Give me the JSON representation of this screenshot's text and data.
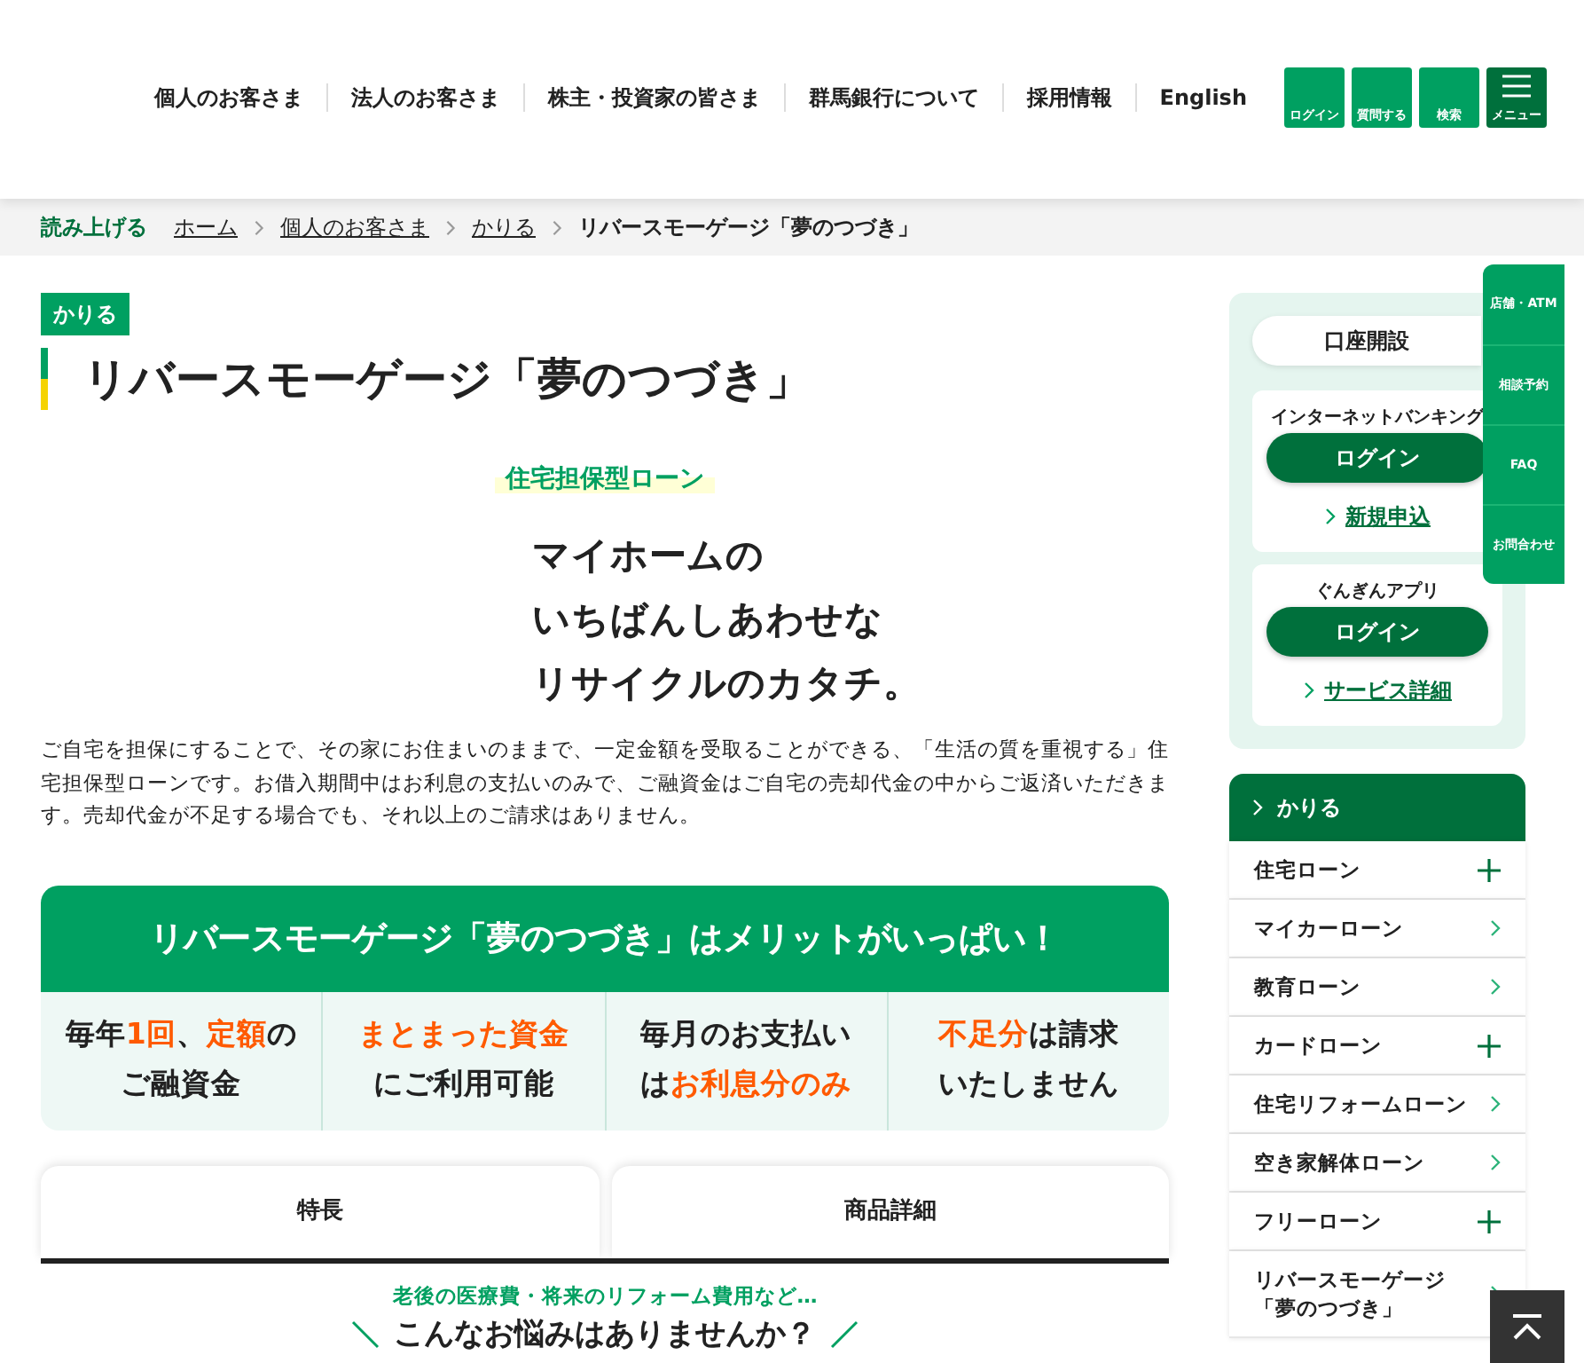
{
  "header": {
    "nav": [
      "個人のお客さま",
      "法人のお客さま",
      "株主・投資家の皆さま",
      "群馬銀行について",
      "採用情報",
      "English"
    ],
    "buttons": [
      {
        "label": "ログイン",
        "kind": "plain"
      },
      {
        "label": "質問する",
        "kind": "plain"
      },
      {
        "label": "検索",
        "kind": "plain"
      },
      {
        "label": "メニュー",
        "kind": "menu"
      }
    ]
  },
  "breadcrumb": {
    "read_aloud": "読み上げる",
    "items": [
      {
        "label": "ホーム",
        "current": false
      },
      {
        "label": "個人のお客さま",
        "current": false
      },
      {
        "label": "かりる",
        "current": false
      },
      {
        "label": "リバースモーゲージ「夢のつづき」",
        "current": true
      }
    ]
  },
  "category_badge": "かりる",
  "title": "リバースモーゲージ「夢のつづき」",
  "loan_type": "住宅担保型ローン",
  "catchphrase": [
    "マイホームの",
    "いちばんしあわせな",
    "リサイクルのカタチ。"
  ],
  "description": "ご自宅を担保にすることで、その家にお住まいのままで、一定金額を受取ることができる、「生活の質を重視する」住宅担保型ローンです。お借入期間中はお利息の支払いのみで、ご融資金はご自宅の売却代金の中からご返済いただきます。売却代金が不足する場合でも、それ以上のご請求はありません。",
  "merits": {
    "heading": "リバースモーゲージ「夢のつづき」はメリットがいっぱい！",
    "items": [
      {
        "lines": [
          [
            {
              "text": "毎年",
              "highlight": false
            },
            {
              "text": "1回",
              "highlight": true
            },
            {
              "text": "、",
              "highlight": false
            },
            {
              "text": "定額",
              "highlight": true
            },
            {
              "text": "の",
              "highlight": false
            }
          ],
          [
            {
              "text": "ご融資金",
              "highlight": false
            }
          ]
        ]
      },
      {
        "lines": [
          [
            {
              "text": "まとまった資金",
              "highlight": true
            }
          ],
          [
            {
              "text": "にご利用可能",
              "highlight": false
            }
          ]
        ]
      },
      {
        "lines": [
          [
            {
              "text": "毎月のお支払い",
              "highlight": false
            }
          ],
          [
            {
              "text": "は",
              "highlight": false
            },
            {
              "text": "お利息分のみ",
              "highlight": true
            }
          ]
        ]
      },
      {
        "lines": [
          [
            {
              "text": "不足分",
              "highlight": true
            },
            {
              "text": "は請求",
              "highlight": false
            }
          ],
          [
            {
              "text": "いたしません",
              "highlight": false
            }
          ]
        ]
      }
    ]
  },
  "tabs": [
    {
      "label": "特長"
    },
    {
      "label": "商品詳細"
    }
  ],
  "worries": {
    "lead": "老後の医療費・将来のリフォーム費用など…",
    "heading": "こんなお悩みはありませんか？"
  },
  "sidebar": {
    "account_opening": "口座開設",
    "services": [
      {
        "title": "インターネットバンキング",
        "button": "ログイン",
        "link": "新規申込"
      },
      {
        "title": "ぐんぎんアプリ",
        "button": "ログイン",
        "link": "サービス詳細"
      }
    ],
    "menu": {
      "title": "かりる",
      "items": [
        {
          "label": "住宅ローン",
          "kind": "expand"
        },
        {
          "label": "マイカーローン",
          "kind": "link"
        },
        {
          "label": "教育ローン",
          "kind": "link"
        },
        {
          "label": "カードローン",
          "kind": "expand"
        },
        {
          "label": "住宅リフォームローン",
          "kind": "link"
        },
        {
          "label": "空き家解体ローン",
          "kind": "link"
        },
        {
          "label": "フリーローン",
          "kind": "expand"
        },
        {
          "label": "リバースモーゲージ「夢のつづき」",
          "kind": "link"
        }
      ]
    }
  },
  "quick_links": [
    "店舗・ATM",
    "相談予約",
    "FAQ",
    "お問合わせ"
  ]
}
